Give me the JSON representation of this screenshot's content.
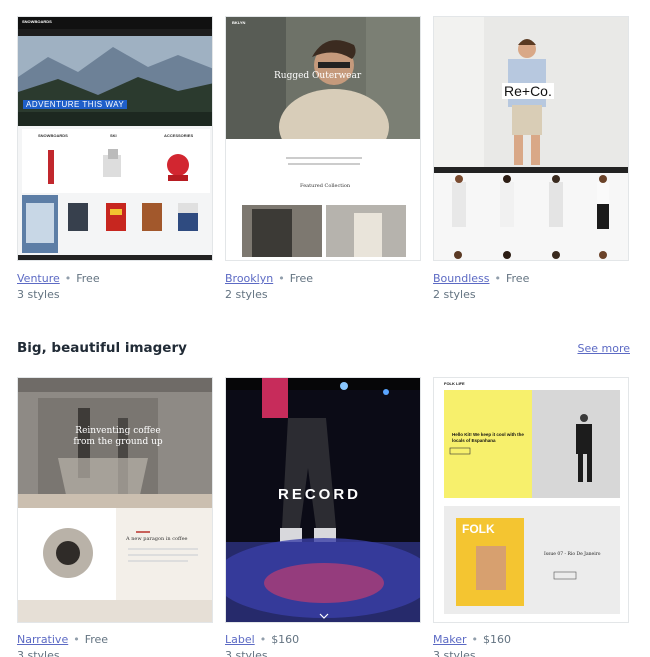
{
  "themes_top": [
    {
      "name": "Venture",
      "price": "Free",
      "styles": "3 styles",
      "preview": {
        "brand": "SNOWBOARDS",
        "hero_text": "ADVENTURE THIS WAY",
        "categories": [
          "SNOWBOARDS",
          "SKI",
          "ACCESSORIES"
        ]
      }
    },
    {
      "name": "Brooklyn",
      "price": "Free",
      "styles": "2 styles",
      "preview": {
        "brand": "BKLYN",
        "hero_text": "Rugged Outerwear",
        "section_text": "Featured Collection"
      }
    },
    {
      "name": "Boundless",
      "price": "Free",
      "styles": "2 styles",
      "preview": {
        "logo": "Re+Co."
      }
    }
  ],
  "section": {
    "title": "Big, beautiful imagery",
    "see_more": "See more"
  },
  "themes_bottom": [
    {
      "name": "Narrative",
      "price": "Free",
      "styles": "3 styles",
      "preview": {
        "hero_text": "Reinventing coffee from the ground up",
        "sub_text": "A new paragon in coffee"
      }
    },
    {
      "name": "Label",
      "price": "$160",
      "styles": "3 styles",
      "preview": {
        "hero_text": "RECORD"
      }
    },
    {
      "name": "Maker",
      "price": "$160",
      "styles": "3 styles",
      "preview": {
        "brand": "FOLK LIFE",
        "headline": "Hello Kit! We keep it cool with the locals of Espanhana",
        "magazine": "FOLK",
        "issue_text": "Issue 07 - Rio De Janeiro"
      }
    }
  ],
  "colors": {
    "link": "#5c6ac4",
    "muted": "#637381",
    "heading": "#212b36"
  }
}
